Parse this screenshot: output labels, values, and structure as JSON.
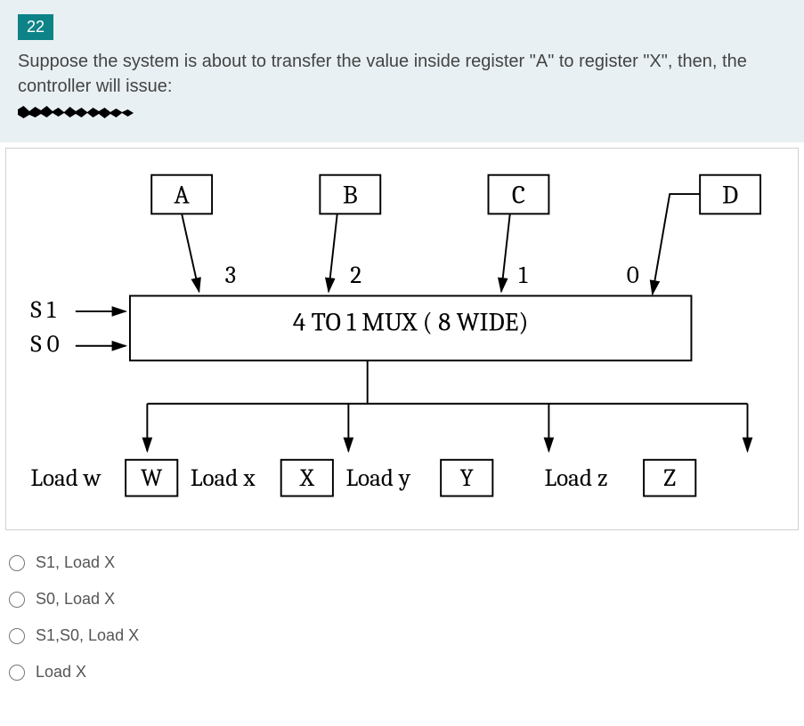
{
  "question": {
    "number": "22",
    "prompt": "Suppose the system is about to transfer the value inside register \"A\" to register \"X\", then, the controller will issue:"
  },
  "diagram": {
    "registers_top": [
      "A",
      "B",
      "C",
      "D"
    ],
    "mux_inputs": [
      "3",
      "2",
      "1",
      "0"
    ],
    "selects": [
      "S 1",
      "S 0"
    ],
    "mux_label": "4 TO 1 MUX ( 8 WIDE)",
    "load_labels": [
      "Load w",
      "Load x",
      "Load y",
      "Load z"
    ],
    "registers_bottom": [
      "W",
      "X",
      "Y",
      "Z"
    ]
  },
  "options": [
    "S1, Load X",
    "S0, Load X",
    "S1,S0, Load X",
    "Load X"
  ]
}
